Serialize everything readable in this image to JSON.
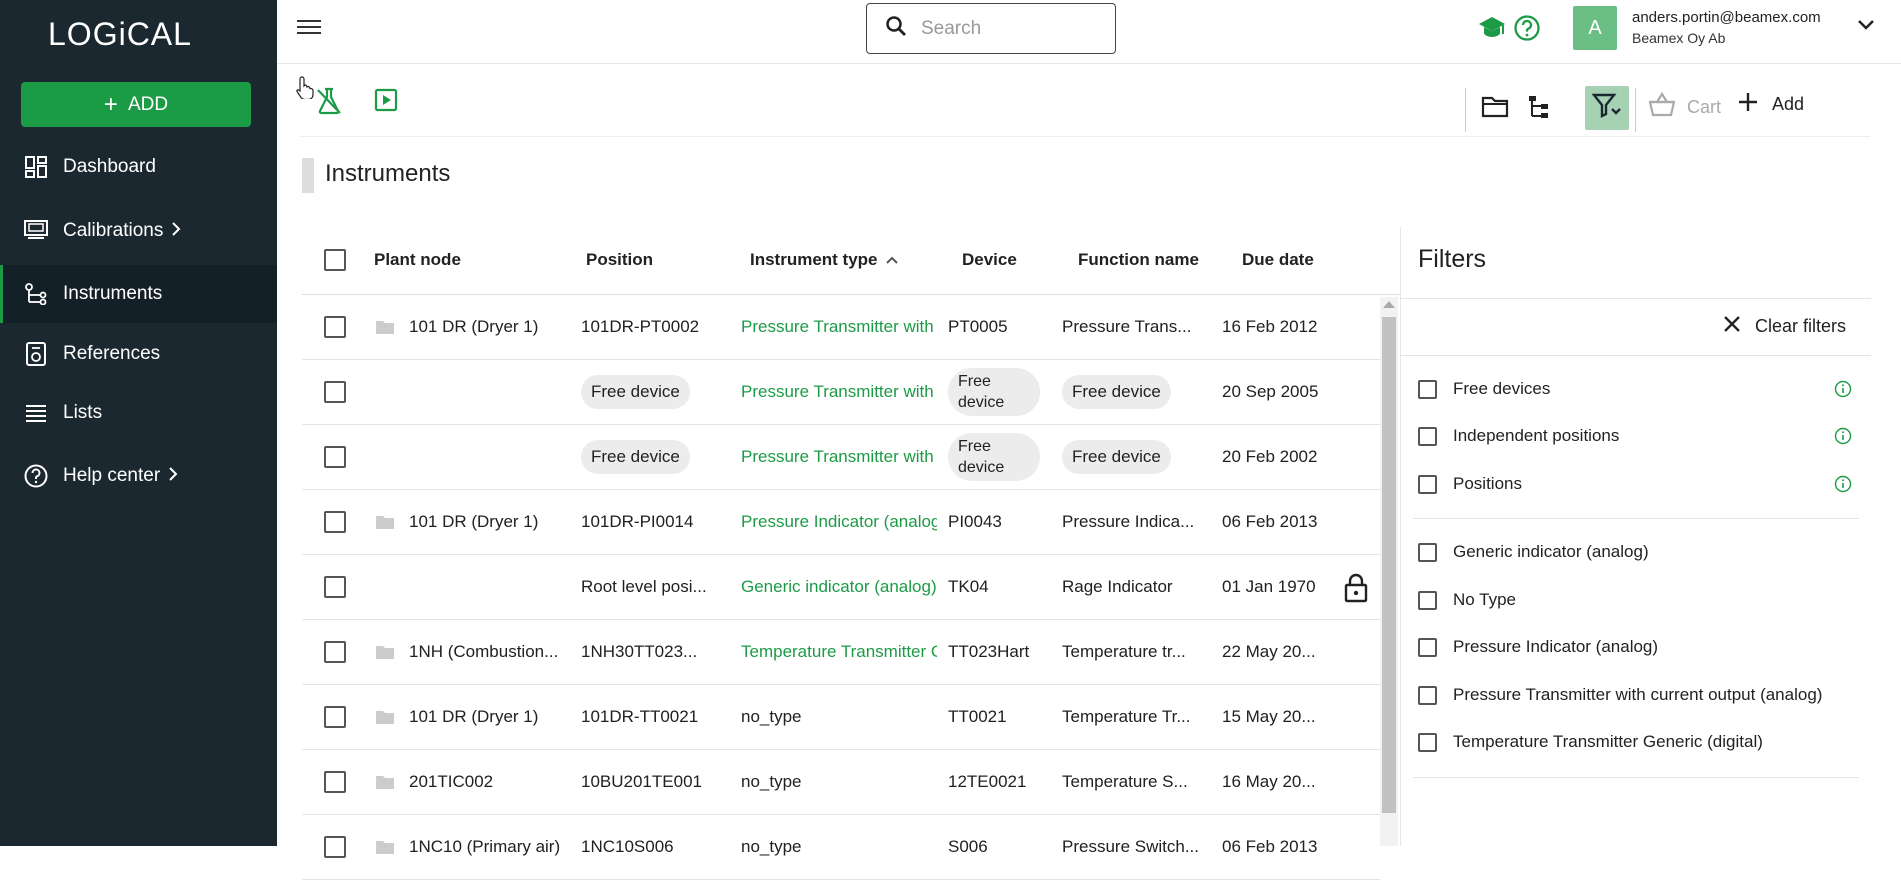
{
  "app": {
    "logo_text": "LOGiCAL"
  },
  "sidebar": {
    "add_label": "ADD",
    "items": [
      {
        "label": "Dashboard",
        "icon": "dashboard-icon"
      },
      {
        "label": "Calibrations",
        "icon": "calibrations-icon",
        "has_chevron": true
      },
      {
        "label": "Instruments",
        "icon": "instruments-icon",
        "active": true
      },
      {
        "label": "References",
        "icon": "references-icon"
      },
      {
        "label": "Lists",
        "icon": "list-icon"
      },
      {
        "label": "Help center",
        "icon": "help-icon",
        "has_chevron": true
      }
    ]
  },
  "topbar": {
    "search_placeholder": "Search",
    "user_initial": "A",
    "user_email": "anders.portin@beamex.com",
    "user_org": "Beamex Oy Ab"
  },
  "toolbar": {
    "cart_label": "Cart",
    "add_label": "Add"
  },
  "page": {
    "title": "Instruments"
  },
  "table": {
    "columns": [
      "Plant node",
      "Position",
      "Instrument type",
      "Device",
      "Function name",
      "Due date"
    ],
    "sorted_column": "Instrument type",
    "rows": [
      {
        "plant": "101 DR (Dryer 1)",
        "position": "101DR-PT0002",
        "type": "Pressure Transmitter with",
        "device": "PT0005",
        "function": "Pressure Trans...",
        "due": "16 Feb 2012"
      },
      {
        "plant": "",
        "position": "Free device",
        "type": "Pressure Transmitter with",
        "device": "Free device",
        "function": "Free device",
        "due": "20 Sep 2005"
      },
      {
        "plant": "",
        "position": "Free device",
        "type": "Pressure Transmitter with",
        "device": "Free device",
        "function": "Free device",
        "due": "20 Feb 2002"
      },
      {
        "plant": "101 DR (Dryer 1)",
        "position": "101DR-PI0014",
        "type": "Pressure Indicator (analog)",
        "device": "PI0043",
        "function": "Pressure Indica...",
        "due": "06 Feb 2013"
      },
      {
        "plant": "",
        "position": "Root level posi...",
        "type": "Generic indicator (analog)",
        "device": "TK04",
        "function": "Rage Indicator",
        "due": "01 Jan 1970",
        "locked": true
      },
      {
        "plant": "1NH (Combustion...",
        "position": "1NH30TT023...",
        "type": "Temperature Transmitter G",
        "device": "TT023Hart",
        "function": "Temperature tr...",
        "due": "22 May 20..."
      },
      {
        "plant": "101 DR (Dryer 1)",
        "position": "101DR-TT0021",
        "type": "no_type",
        "device": "TT0021",
        "function": "Temperature Tr...",
        "due": "15 May 20..."
      },
      {
        "plant": "201TIC002",
        "position": "10BU201TE001",
        "type": "no_type",
        "device": "12TE0021",
        "function": "Temperature S...",
        "due": "16 May 20..."
      },
      {
        "plant": "1NC10 (Primary air)",
        "position": "1NC10S006",
        "type": "no_type",
        "device": "S006",
        "function": "Pressure Switch...",
        "due": "06 Feb 2013"
      }
    ]
  },
  "filters": {
    "title": "Filters",
    "clear_label": "Clear filters",
    "group1": [
      "Free devices",
      "Independent positions",
      "Positions"
    ],
    "group2": [
      "Generic indicator (analog)",
      "No Type",
      "Pressure Indicator (analog)",
      "Pressure Transmitter with current output (analog)",
      "Temperature Transmitter Generic (digital)"
    ]
  },
  "colors": {
    "accent": "#1c9b46",
    "sidebar_bg": "#1b2830"
  }
}
